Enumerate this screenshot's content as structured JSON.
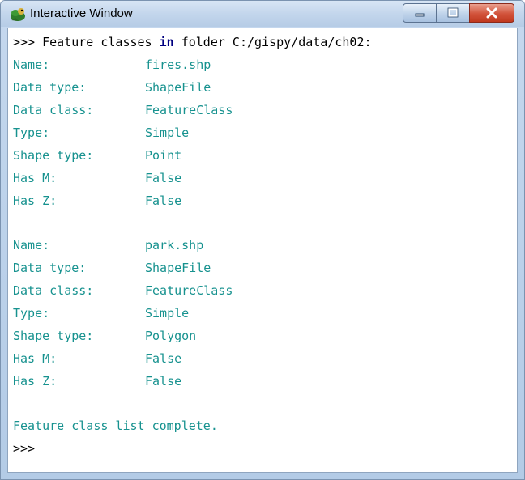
{
  "window": {
    "title": "Interactive Window"
  },
  "colors": {
    "output_text": "#17928f",
    "prompt_text": "#000000",
    "keyword": "#000080",
    "close_button": "#c8452c"
  },
  "console": {
    "header": {
      "prompt": ">>>",
      "before_keyword": "Feature classes",
      "keyword": "in",
      "after_keyword": "folder C:/gispy/data/ch02:"
    },
    "records": [
      {
        "fields": [
          {
            "label": "Name:",
            "value": "fires.shp"
          },
          {
            "label": "Data type:",
            "value": "ShapeFile"
          },
          {
            "label": "Data class:",
            "value": "FeatureClass"
          },
          {
            "label": "Type:",
            "value": "Simple"
          },
          {
            "label": "Shape type:",
            "value": "Point"
          },
          {
            "label": "Has M:",
            "value": "False"
          },
          {
            "label": "Has Z:",
            "value": "False"
          }
        ]
      },
      {
        "fields": [
          {
            "label": "Name:",
            "value": "park.shp"
          },
          {
            "label": "Data type:",
            "value": "ShapeFile"
          },
          {
            "label": "Data class:",
            "value": "FeatureClass"
          },
          {
            "label": "Type:",
            "value": "Simple"
          },
          {
            "label": "Shape type:",
            "value": "Polygon"
          },
          {
            "label": "Has M:",
            "value": "False"
          },
          {
            "label": "Has Z:",
            "value": "False"
          }
        ]
      }
    ],
    "footer": "Feature class list complete.",
    "final_prompt": ">>>"
  }
}
